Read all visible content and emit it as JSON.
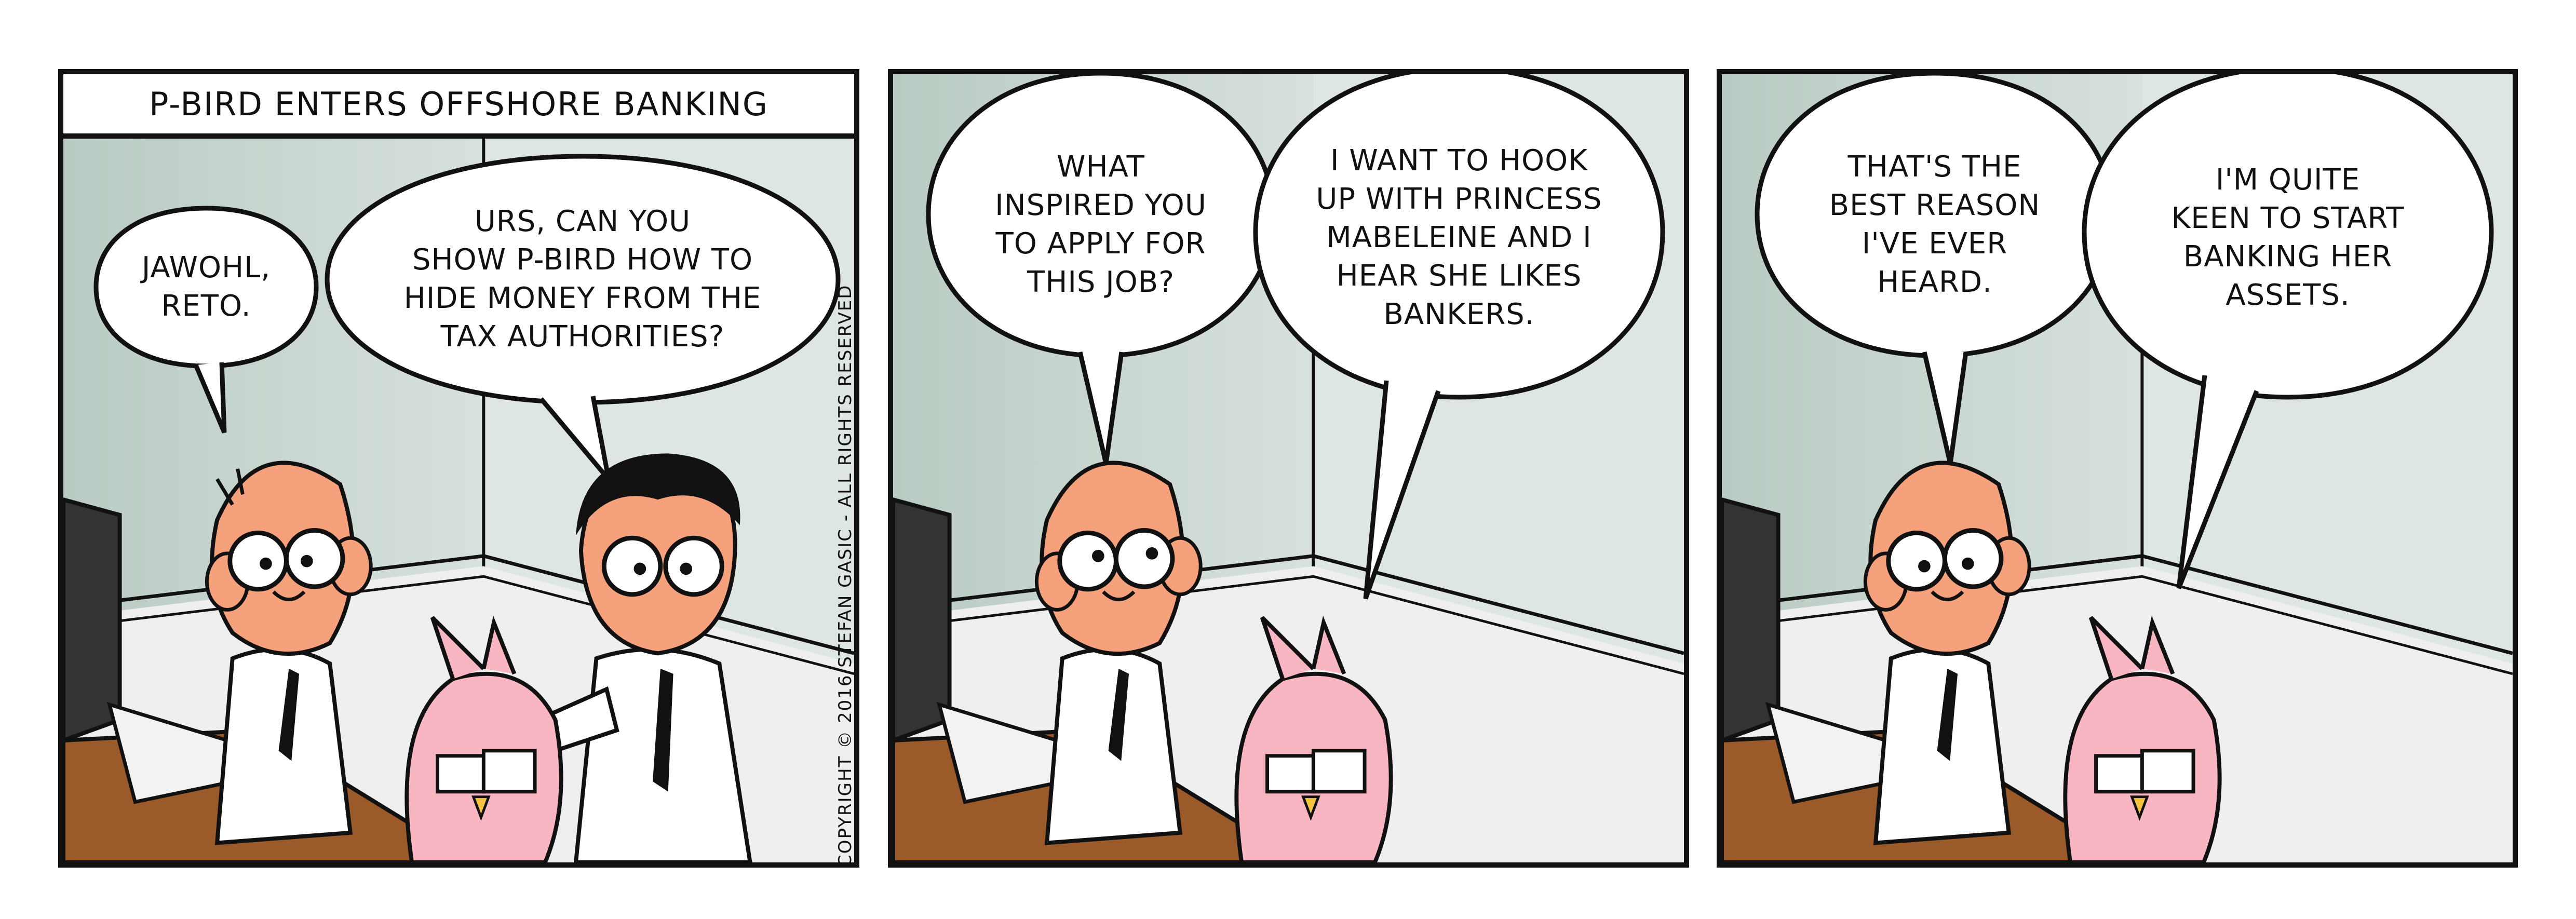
{
  "strip": {
    "title": "P-BIRD ENTERS OFFSHORE BANKING",
    "copyright": "COPYRIGHT © 2016 STEFAN GASIC - ALL RIGHTS RESERVED"
  },
  "panels": [
    {
      "bubbles": [
        {
          "text": "JAWOHL,\nRETO."
        },
        {
          "text": "URS, CAN YOU\nSHOW P-BIRD HOW TO\nHIDE MONEY FROM THE\nTAX AUTHORITIES?"
        }
      ]
    },
    {
      "bubbles": [
        {
          "text": "WHAT\nINSPIRED YOU\nTO APPLY FOR\nTHIS JOB?"
        },
        {
          "text": "I WANT TO HOOK\nUP WITH PRINCESS\nMABELEINE AND I\nHEAR SHE LIKES\nBANKERS."
        }
      ]
    },
    {
      "bubbles": [
        {
          "text": "THAT'S THE\nBEST REASON\nI'VE EVER\nHEARD."
        },
        {
          "text": "I'M QUITE\nKEEN TO START\nBANKING HER\nASSETS."
        }
      ]
    }
  ],
  "colors": {
    "wall": "#c9d6cf",
    "wall_light": "#eef2ef",
    "floor": "#ececec",
    "desk": "#9a5a2a",
    "skin": "#f4a17c",
    "bird": "#f7b6c2",
    "outline": "#111111"
  }
}
